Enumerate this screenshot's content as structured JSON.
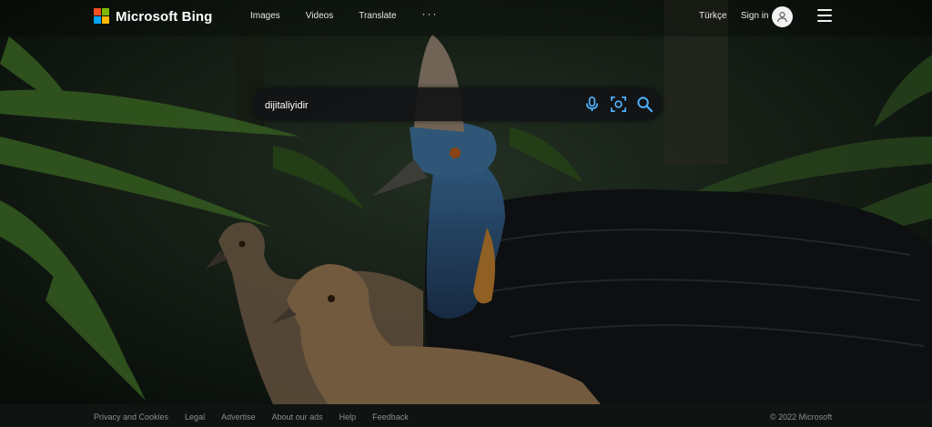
{
  "brand": {
    "name": "Microsoft Bing",
    "logo_colors": [
      "#f25022",
      "#7fba00",
      "#00a4ef",
      "#ffb900"
    ]
  },
  "nav": {
    "items": [
      "Images",
      "Videos",
      "Translate"
    ],
    "more_label": "···"
  },
  "header": {
    "language": "Türkçe",
    "signin": "Sign in"
  },
  "search": {
    "value": "dijitaliyidir",
    "icons": [
      "microphone-icon",
      "visual-search-icon",
      "search-icon"
    ],
    "icon_color": "#4fb3ff"
  },
  "footer": {
    "links": [
      "Privacy and Cookies",
      "Legal",
      "Advertise",
      "About our ads",
      "Help",
      "Feedback"
    ],
    "copyright": "© 2022 Microsoft"
  }
}
